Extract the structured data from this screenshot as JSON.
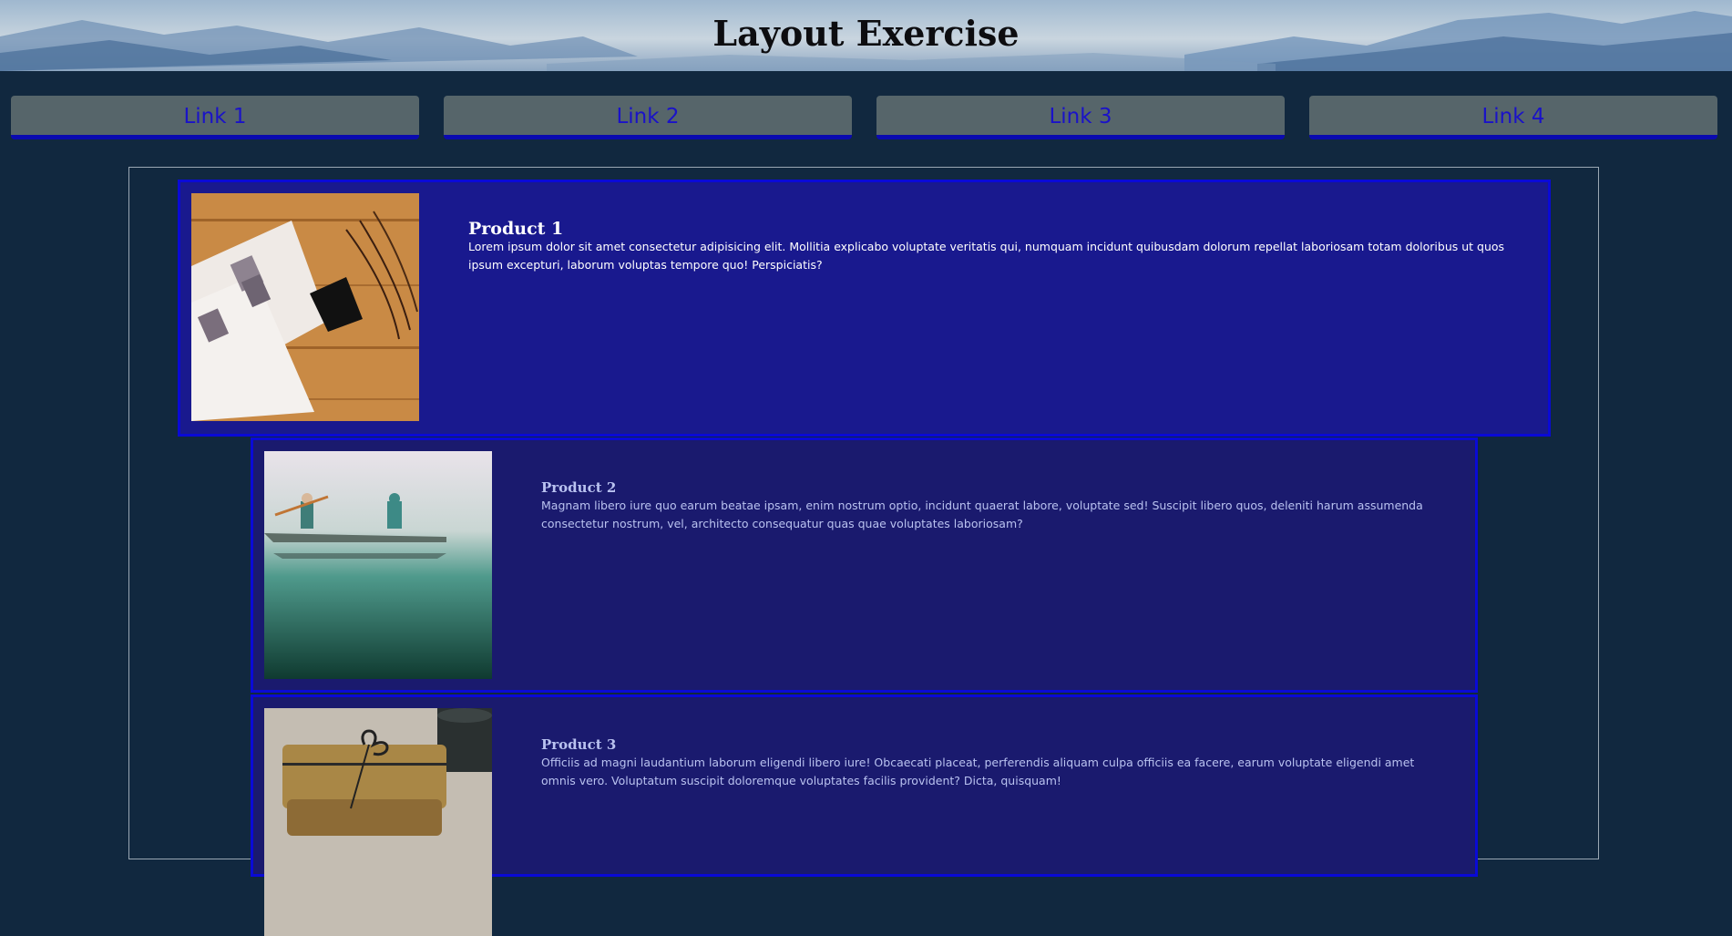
{
  "header": {
    "title": "Layout Exercise"
  },
  "nav": {
    "links": [
      {
        "label": "Link 1"
      },
      {
        "label": "Link 2"
      },
      {
        "label": "Link 3"
      },
      {
        "label": "Link 4"
      }
    ]
  },
  "products": [
    {
      "title": "Product 1",
      "description": "Lorem ipsum dolor sit amet consectetur adipisicing elit. Mollitia explicabo voluptate veritatis qui, numquam incidunt quibusdam dolorum repellat laboriosam totam doloribus ut quos ipsum excepturi, laborum voluptas tempore quo! Perspiciatis?"
    },
    {
      "title": "Product 2",
      "description": "Magnam libero iure quo earum beatae ipsam, enim nostrum optio, incidunt quaerat labore, voluptate sed! Suscipit libero quos, deleniti harum assumenda consectetur nostrum, vel, architecto consequatur quas quae voluptates laboriosam?"
    },
    {
      "title": "Product 3",
      "description": "Officiis ad magni laudantium laborum eligendi libero iure! Obcaecati placeat, perferendis aliquam culpa officiis ea facere, earum voluptate eligendi amet omnis vero. Voluptatum suscipit doloremque voluptates facilis provident? Dicta, quisquam!"
    }
  ],
  "colors": {
    "page_background": "#11283f",
    "nav_button": "#56656a",
    "nav_text": "#1a12c8",
    "product_border": "#0a0ad6",
    "product_1_background": "#19198e",
    "product_background": "#1a1a6e"
  }
}
